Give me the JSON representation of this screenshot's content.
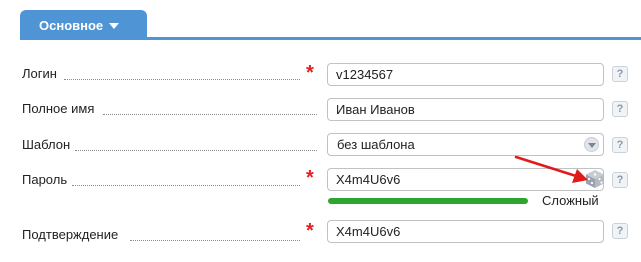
{
  "tab": {
    "label": "Основное"
  },
  "fields": {
    "login": {
      "label": "Логин",
      "value": "v1234567"
    },
    "fullname": {
      "label": "Полное имя",
      "value": "Иван Иванов"
    },
    "template": {
      "label": "Шаблон",
      "value": "без шаблона"
    },
    "password": {
      "label": "Пароль",
      "value": "X4m4U6v6"
    },
    "confirm": {
      "label": "Подтверждение",
      "value": "X4m4U6v6"
    }
  },
  "required_mark": "*",
  "help_glyph": "?",
  "password_strength": {
    "label": "Сложный",
    "level": 1.0
  },
  "colors": {
    "accent": "#4f95d5",
    "required": "#e02020",
    "strength": "#2ca531",
    "annotation": "#e01b1b"
  },
  "icons": {
    "tab_caret": "chevron-down-icon",
    "generate": "dice-icon",
    "help": "help-icon",
    "annotation": "arrow-icon"
  }
}
